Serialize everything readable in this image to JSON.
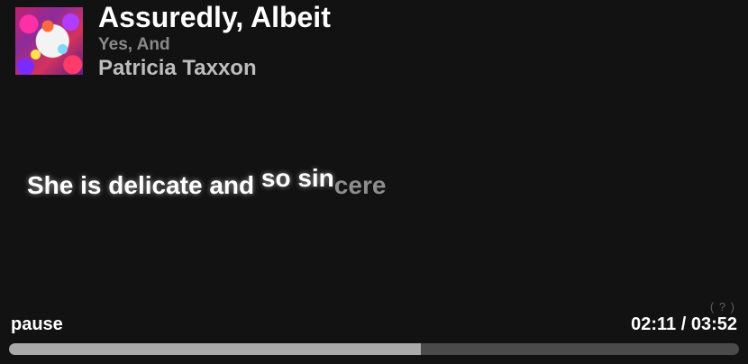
{
  "track": {
    "title": "Assuredly, Albeit",
    "album": "Yes, And",
    "artist": "Patricia Taxxon",
    "album_art_icon": "album-art-image"
  },
  "lyrics": {
    "sung_part": "She is delicate and ",
    "sung_raised_part": "so sin",
    "unsung_part": "cere"
  },
  "controls": {
    "pause_label": "pause",
    "help_label": "( ? )",
    "time_display": "02:11 / 03:52",
    "progress_fraction": 0.5647
  },
  "colors": {
    "background": "#121212",
    "progress_fill": "#a9a9a9",
    "progress_track": "#4a4a4a"
  }
}
